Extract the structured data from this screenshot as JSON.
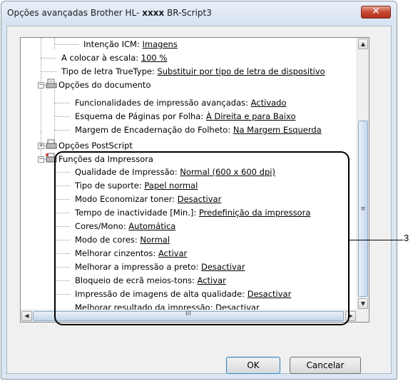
{
  "window": {
    "title_prefix": "Opções avançadas Brother HL-",
    "title_model": "xxxx",
    "title_suffix": "BR-Script3",
    "close_symbol": "✕"
  },
  "tree": {
    "top_settings": [
      {
        "label": "Intenção ICM:",
        "value": "Imagens"
      },
      {
        "label": "A colocar à escala:",
        "value": "100 %"
      },
      {
        "label": "Tipo de letra TrueType:",
        "value": "Substituir por tipo de letra de dispositivo"
      }
    ],
    "document_options": {
      "label": "Opções do documento",
      "items": [
        {
          "label": "Funcionalidades de impressão avançadas:",
          "value": "Activado"
        },
        {
          "label": "Esquema de Páginas por Folha:",
          "value": "À Direita e para Baixo"
        },
        {
          "label": "Margem de Encadernação do Folheto:",
          "value": "Na Margem Esquerda"
        }
      ]
    },
    "postscript_options": {
      "label": "Opções PostScript"
    },
    "printer_features": {
      "label": "Funções da Impressora",
      "items": [
        {
          "label": "Qualidade de Impressão:",
          "value": "Normal (600 x 600 dpi)"
        },
        {
          "label": "Tipo de suporte:",
          "value": "Papel normal"
        },
        {
          "label": "Modo Economizar toner:",
          "value": "Desactivar"
        },
        {
          "label": "Tempo de inactividade [Min.]:",
          "value": "Predefinição da impressora"
        },
        {
          "label": "Cores/Mono:",
          "value": "Automática"
        },
        {
          "label": "Modo de cores:",
          "value": "Normal"
        },
        {
          "label": "Melhorar cinzentos:",
          "value": "Activar"
        },
        {
          "label": "Melhorar a impressão a preto:",
          "value": "Desactivar"
        },
        {
          "label": "Bloqueio de ecrã meios-tons:",
          "value": "Activar"
        },
        {
          "label": "Impressão de imagens de alta qualidade:",
          "value": "Desactivar"
        },
        {
          "label": "Melhorar resultado da impressão:",
          "value": "Desactivar"
        }
      ]
    }
  },
  "scrollbar": {
    "grip": "≡",
    "hgrip": "III",
    "up": "▲",
    "down": "▼",
    "left": "◀",
    "right": "▶"
  },
  "buttons": {
    "ok": "OK",
    "cancel": "Cancelar"
  },
  "callout": {
    "number": "3"
  }
}
